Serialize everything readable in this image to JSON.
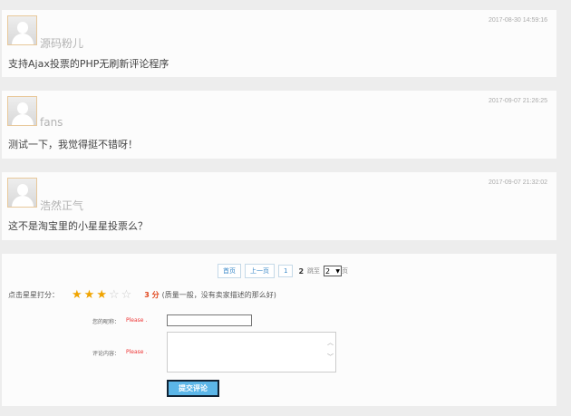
{
  "comments": [
    {
      "name": "源码粉儿",
      "time": "2017-08-30 14:59:16",
      "text": "支持Ajax投票的PHP无刷新评论程序"
    },
    {
      "name": "fans",
      "time": "2017-09-07 21:26:25",
      "text": "测试一下，我觉得挺不错呀！"
    },
    {
      "name": "浩然正气",
      "time": "2017-09-07 21:32:02",
      "text": "这不是淘宝里的小星星投票么？"
    }
  ],
  "pager": {
    "first": "首页",
    "prev": "上一页",
    "page1": "1",
    "current": "2",
    "jump_prefix": "跳至",
    "jump_value": "2",
    "jump_suffix": "页"
  },
  "rating": {
    "label": "点击星星打分：",
    "value": 3,
    "max": 5,
    "score": "3 分",
    "desc": "(质量一般，没有卖家描述的那么好)"
  },
  "form": {
    "nick_label": "您的昵称：",
    "nick_hint": "Please .",
    "nick_value": "",
    "content_label": "评论内容：",
    "content_hint": "Please .",
    "content_value": "",
    "submit": "提交评论"
  }
}
